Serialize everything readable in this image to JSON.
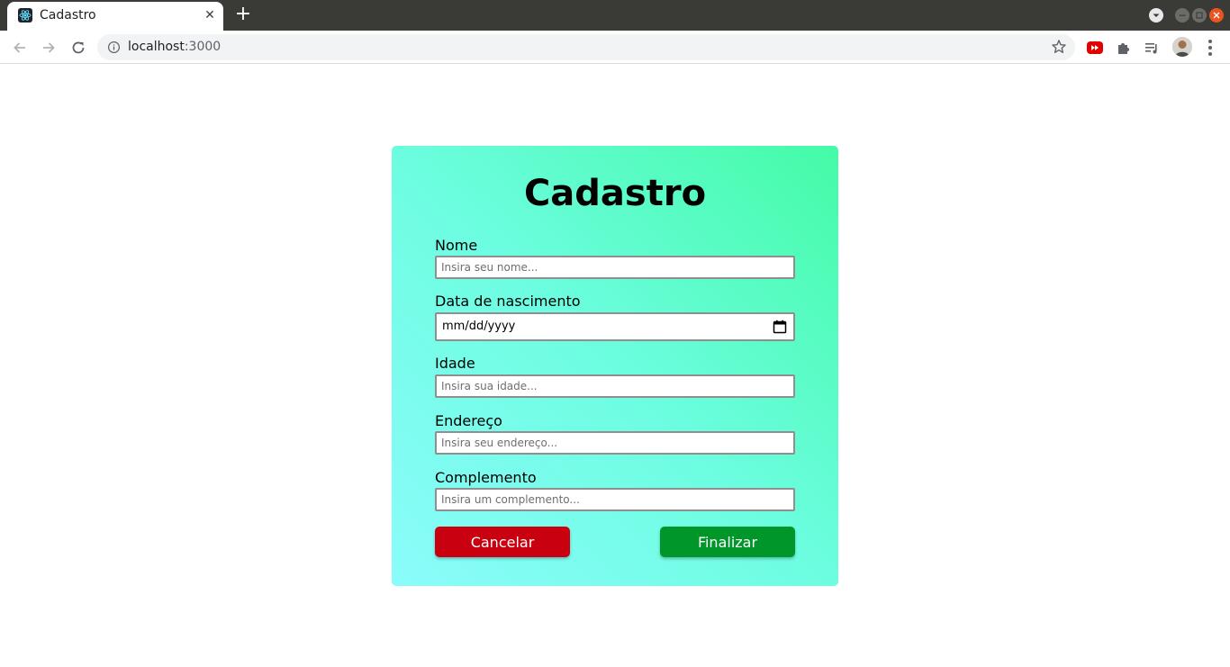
{
  "browser": {
    "tab_title": "Cadastro",
    "tab_close_glyph": "✕",
    "new_tab_glyph": "+",
    "url": "localhost:3000",
    "url_host": "localhost",
    "url_port": ":3000"
  },
  "form": {
    "title": "Cadastro",
    "fields": [
      {
        "label": "Nome",
        "placeholder": "Insira seu nome..."
      },
      {
        "label": "Data de nascimento",
        "placeholder": "mm/dd/yyyy"
      },
      {
        "label": "Idade",
        "placeholder": "Insira sua idade..."
      },
      {
        "label": "Endereço",
        "placeholder": "Insira seu endereço..."
      },
      {
        "label": "Complemento",
        "placeholder": "Insira um complemento..."
      }
    ],
    "cancel_label": "Cancelar",
    "finish_label": "Finalizar"
  },
  "colors": {
    "cancel_button": "#c8000f",
    "finish_button": "#009629",
    "card_gradient_start": "#8bfcfb",
    "card_gradient_end": "#44fba6"
  },
  "icons": {
    "favicon": "react-icon",
    "back": "back-arrow-icon",
    "forward": "forward-arrow-icon",
    "reload": "reload-icon",
    "site_info": "info-icon",
    "bookmark": "star-icon",
    "calendar": "calendar-icon"
  }
}
